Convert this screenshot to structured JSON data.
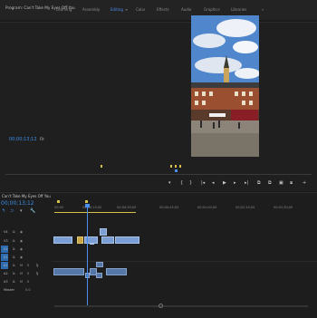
{
  "workspaces": [
    "Learning",
    "Assembly",
    "Editing",
    "Color",
    "Effects",
    "Audio",
    "Graphics",
    "Libraries",
    "»"
  ],
  "active_workspace": "Editing",
  "program": {
    "title": "Program: Can't Take My Eyes Off You",
    "timecode": "00;00;13;12",
    "fit": "Fit",
    "controls": [
      "▾",
      "{",
      "}",
      "|◂",
      "◂|",
      "◂",
      "▶",
      "▸",
      "▸|",
      "⧉",
      "⧉",
      "▣",
      "⧈",
      "+"
    ]
  },
  "timeline": {
    "sequence": "Can't Take My Eyes Off You",
    "timecode": "00;00;13;12",
    "ruler": [
      "00;00",
      "00;00;15;00",
      "00;00;30;00",
      "00;00;45;00",
      "00;01;00;00",
      "00;01;15;00",
      "00;01;30;00"
    ],
    "tracks": [
      {
        "name": "V4"
      },
      {
        "name": "V3"
      },
      {
        "name": "V2"
      },
      {
        "name": "V1"
      },
      {
        "name": "A1"
      },
      {
        "name": "A2"
      },
      {
        "name": "A3"
      },
      {
        "name": "A4"
      }
    ],
    "master": "Master",
    "master_val": "0.0"
  },
  "colors": {
    "accent": "#4c8ef0",
    "clip_video": "#7b9ed4",
    "clip_audio": "#5577a8"
  }
}
